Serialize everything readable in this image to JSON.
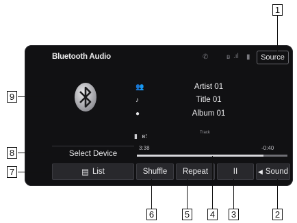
{
  "header": {
    "title": "Bluetooth Audio",
    "source_label": "Source"
  },
  "status_icons": [
    "phone-icon",
    "bluetooth-signal-icon",
    "signal-bars-icon",
    "battery-icon"
  ],
  "track": {
    "artist": "Artist 01",
    "title": "Title 01",
    "album": "Album 01",
    "label": "Track"
  },
  "playback": {
    "elapsed": "3:38",
    "remaining": "-0:40",
    "progress": 0.84
  },
  "left_panel": {
    "select_device_label": "Select Device"
  },
  "bottom_bar": {
    "list_label": "List",
    "shuffle_label": "Shuffle",
    "repeat_label": "Repeat",
    "pause_label": "II",
    "sound_label": "Sound"
  },
  "callouts": [
    "1",
    "2",
    "3",
    "4",
    "5",
    "6",
    "7",
    "8",
    "9"
  ],
  "colors": {
    "screen_bg": "#111113",
    "button_bg": "#28282c",
    "text": "#ececee"
  }
}
